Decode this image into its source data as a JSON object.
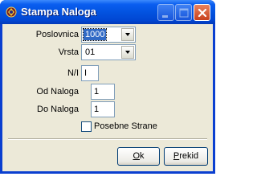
{
  "window": {
    "title": "Stampa Naloga"
  },
  "form": {
    "poslovnica_label": "Poslovnica",
    "poslovnica_value": "1000",
    "vrsta_label": "Vrsta",
    "vrsta_value": "01",
    "ni_label": "N/I",
    "ni_value": "I",
    "od_naloga_label": "Od Naloga",
    "od_naloga_value": "1",
    "do_naloga_label": "Do Naloga",
    "do_naloga_value": "1",
    "posebne_strane_label": "Posebne Strane",
    "posebne_strane_checked": false
  },
  "buttons": {
    "ok_mnemonic": "O",
    "ok_rest": "k",
    "prekid_mnemonic": "P",
    "prekid_rest": "rekid"
  },
  "icons": {
    "app": "app-icon",
    "minimize": "minimize-icon",
    "maximize": "maximize-icon",
    "close": "close-icon",
    "dropdown": "chevron-down-icon"
  },
  "colors": {
    "titlebar": "#0353e0",
    "client_bg": "#ece9d8",
    "selection": "#316ac5",
    "close_button": "#c8401c"
  }
}
